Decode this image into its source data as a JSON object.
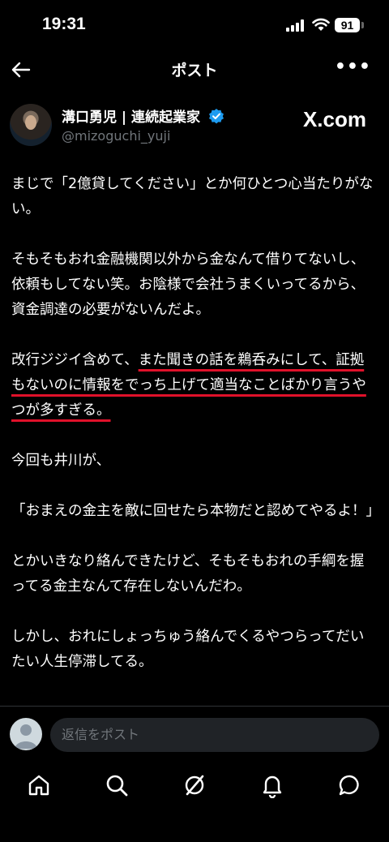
{
  "status": {
    "time": "19:31",
    "battery": "91"
  },
  "header": {
    "title": "ポスト"
  },
  "author": {
    "name": "溝口勇児 | 連続起業家",
    "handle": "@mizoguchi_yuji",
    "watermark": "X.com"
  },
  "post": {
    "p1": "まじで「2億貸してください」とか何ひとつ心当たりがない。",
    "p2": "そもそもおれ金融機関以外から金なんて借りてないし、依頼もしてない笑。お陰様で会社うまくいってるから、資金調達の必要がないんだよ。",
    "p3a": "改行ジジイ含めて、",
    "p3b": "また聞きの話を鵜呑みにして、証拠もないのに情報をでっち上げて適当なことばかり言うやつが多すぎる。",
    "p4": "今回も井川が、",
    "p5": "「おまえの金主を敵に回せたら本物だと認めてやるよ！」",
    "p6": "とかいきなり絡んできたけど、そもそもおれの手綱を握ってる金主なんて存在しないんだわ。",
    "p7": "しかし、おれにしょっちゅう絡んでくるやつらってだいたい人生停滞してる。"
  },
  "reply": {
    "placeholder": "返信をポスト"
  },
  "colors": {
    "highlight_underline": "#e0112a",
    "verified": "#1d9bf0"
  }
}
